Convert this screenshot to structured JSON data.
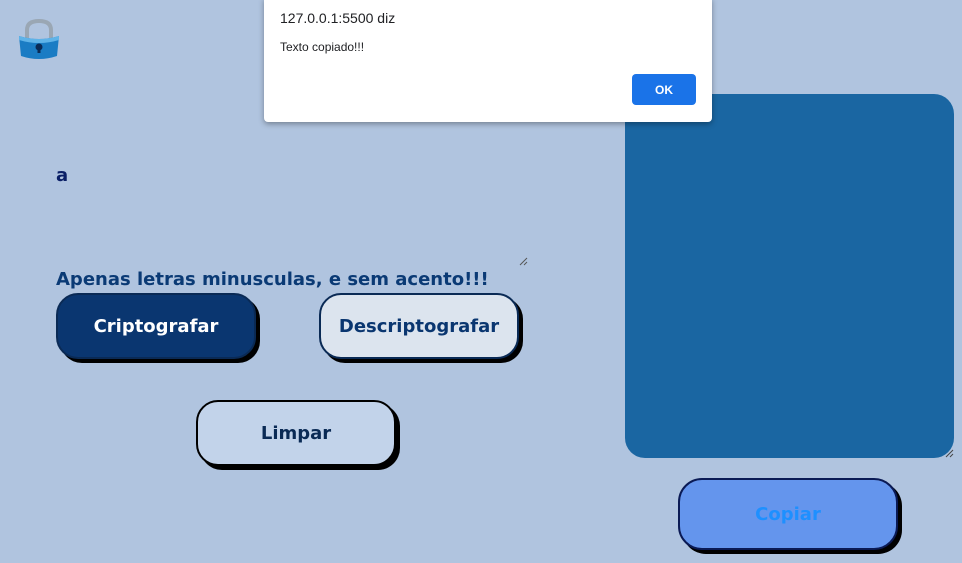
{
  "app": {
    "logo_icon": "padlock-icon"
  },
  "encoder": {
    "input_value": "a",
    "hint": "Apenas letras minusculas, e sem acento!!!",
    "encrypt_label": "Criptografar",
    "decrypt_label": "Descriptografar",
    "clear_label": "Limpar"
  },
  "output": {
    "value": "",
    "copy_label": "Copiar"
  },
  "alert_dialog": {
    "origin": "127.0.0.1:5500 diz",
    "message": "Texto copiado!!!",
    "ok_label": "OK"
  },
  "colors": {
    "page_background": "#b0c4df",
    "encrypt_button": "#0a3670",
    "output_panel": "#1a66a2",
    "copy_button": "#6495ed",
    "dialog_ok": "#1a73e8"
  }
}
